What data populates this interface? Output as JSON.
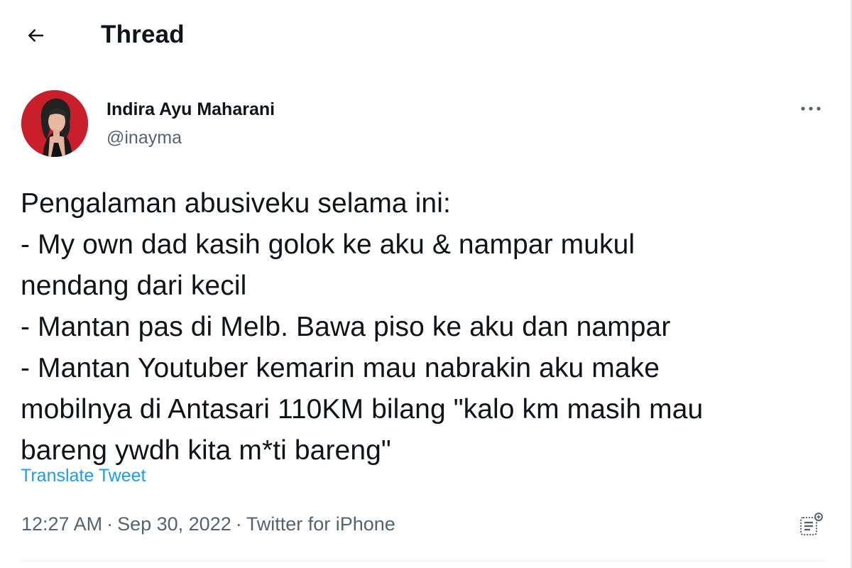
{
  "header": {
    "back_icon": "arrow-left-icon",
    "title": "Thread"
  },
  "tweet": {
    "author": {
      "name": "Indira Ayu Maharani",
      "handle": "@inayma",
      "avatar_bg": "#c81f2a"
    },
    "more_icon": "more-horizontal-icon",
    "text_lines": [
      "Pengalaman abusiveku selama ini:",
      "- My own dad kasih golok ke aku & nampar mukul",
      "nendang dari kecil",
      "- Mantan pas di Melb. Bawa piso ke aku dan nampar",
      "- Mantan Youtuber kemarin mau nabrakin aku make",
      "mobilnya di Antasari 110KM bilang \"kalo km masih mau",
      "bareng ywdh kita m*ti bareng\""
    ],
    "translate_label": "Translate Tweet",
    "time": "12:27 AM",
    "date": "Sep 30, 2022",
    "source": "Twitter for iPhone",
    "separator": "·",
    "analytics_icon": "analytics-icon"
  },
  "colors": {
    "text_primary": "#0f1419",
    "text_secondary": "#536471",
    "link": "#1d9bf0"
  }
}
